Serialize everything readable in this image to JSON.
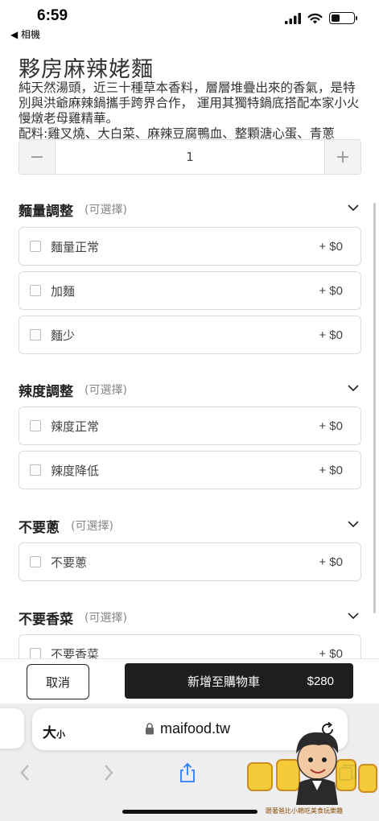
{
  "status_bar": {
    "time": "6:59",
    "back_app": "◀ 相機"
  },
  "item": {
    "title": "夥房麻辣姥麵",
    "description": "純天然湯頭，近三十種草本香料，層層堆疊出來的香氣，是特別與洪爺麻辣鍋攜手跨界合作， 運用其獨特鍋底搭配本家小火慢燉老母雞精華。\n配料:雞叉燒、大白菜、麻辣豆腐鴨血、整顆溏心蛋、青蔥",
    "quantity": "1",
    "minus_symbol": "−",
    "plus_symbol": "+"
  },
  "groups": [
    {
      "title": "麵量調整",
      "optional": "(可選擇)",
      "options": [
        {
          "label": "麵量正常",
          "price": "+ $0"
        },
        {
          "label": "加麵",
          "price": "+ $0"
        },
        {
          "label": "麵少",
          "price": "+ $0"
        }
      ]
    },
    {
      "title": "辣度調整",
      "optional": "(可選擇)",
      "options": [
        {
          "label": "辣度正常",
          "price": "+ $0"
        },
        {
          "label": "辣度降低",
          "price": "+ $0"
        }
      ]
    },
    {
      "title": "不要蔥",
      "optional": "(可選擇)",
      "options": [
        {
          "label": "不要蔥",
          "price": "+ $0"
        }
      ]
    },
    {
      "title": "不要香菜",
      "optional": "(可選擇)",
      "options": [
        {
          "label": "不要香菜",
          "price": "+ $0"
        }
      ]
    }
  ],
  "actions": {
    "cancel_label": "取消",
    "add_label": "新增至購物車",
    "add_price": "$280"
  },
  "browser": {
    "text_size_label": "大",
    "text_size_small": "小",
    "url": "maifood.tw"
  },
  "watermark": {
    "text": "PAPA",
    "caption": "跟著爸比小賴吃美食玩樂趣"
  },
  "icons": {
    "signal": "signal-icon",
    "wifi": "wifi-icon",
    "battery": "battery-icon",
    "chevron": "chevron-down-icon",
    "lock": "lock-icon",
    "reload": "reload-icon",
    "back": "back-arrow-icon",
    "forward": "forward-arrow-icon",
    "share": "share-icon",
    "tabs": "tabs-icon"
  },
  "colors": {
    "primary_button": "#1e1e1e",
    "browser_bar": "#eeeef0",
    "ios_blue": "#2f7cf6"
  }
}
